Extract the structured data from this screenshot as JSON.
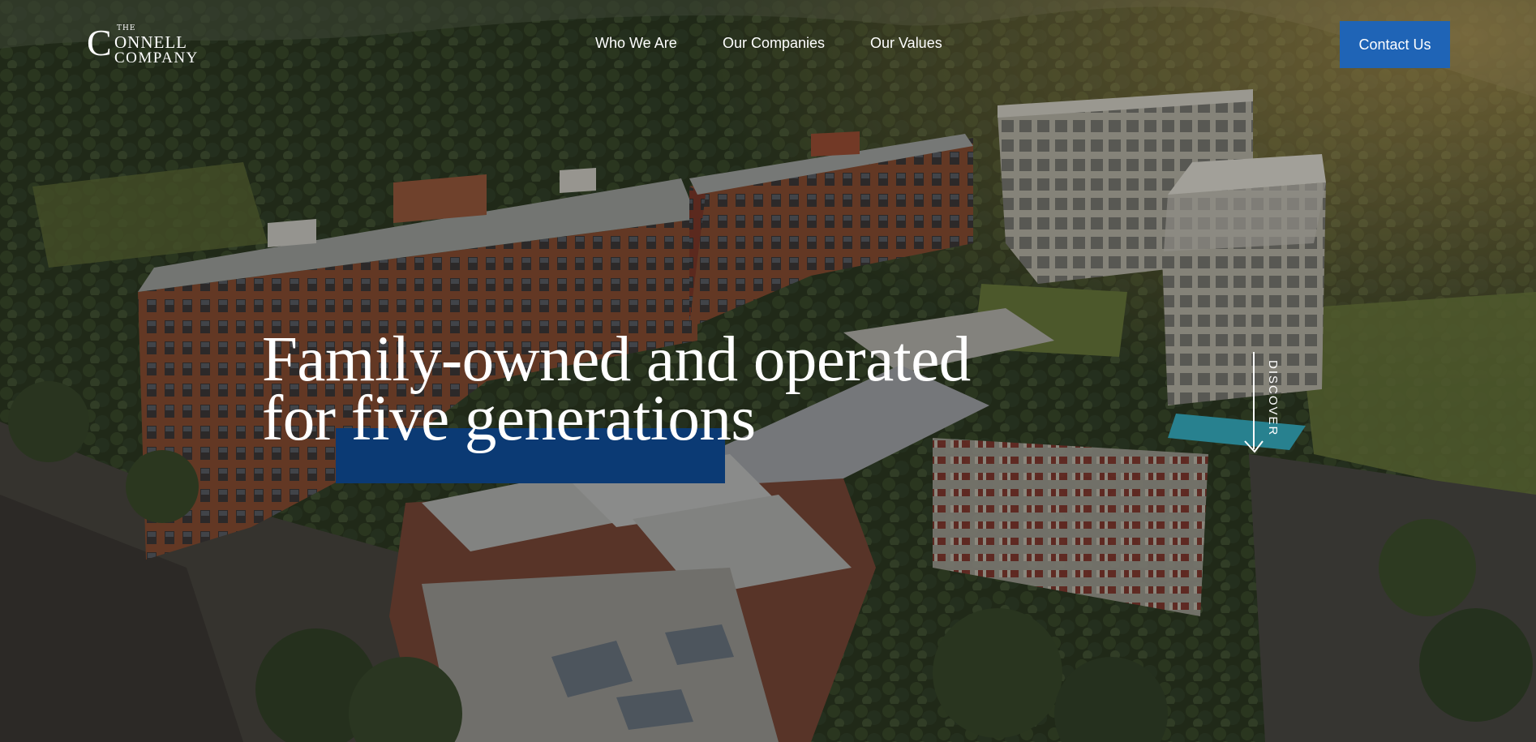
{
  "brand": {
    "logo_the": "THE",
    "logo_initial": "C",
    "logo_connell": "ONNELL",
    "logo_company": "COMPANY"
  },
  "nav": {
    "items": [
      {
        "label": "Who We Are"
      },
      {
        "label": "Our Companies"
      },
      {
        "label": "Our Values"
      }
    ],
    "contact_label": "Contact Us"
  },
  "hero": {
    "headline_line1": "Family-owned and operated",
    "headline_line2": "for five generations",
    "discover_label": "DISCOVER",
    "background_image": "aerial-rendering-mixed-use-development"
  },
  "colors": {
    "contact_button": "#1f64b6",
    "headline_accent": "#0b3a74",
    "text": "#ffffff"
  }
}
